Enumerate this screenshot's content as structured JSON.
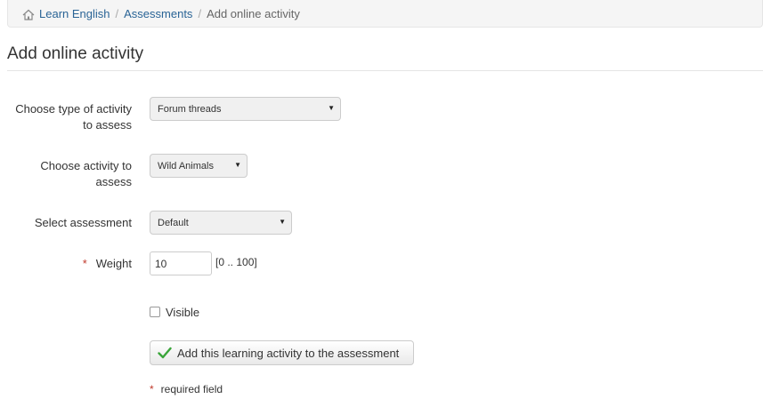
{
  "breadcrumb": {
    "items": [
      "Learn English",
      "Assessments"
    ],
    "separator": "/",
    "current": "Add online activity"
  },
  "page": {
    "title": "Add online activity"
  },
  "form": {
    "activity_type": {
      "label": "Choose type of activity to assess",
      "value": "Forum threads"
    },
    "activity": {
      "label": "Choose activity to assess",
      "value": "Wild Animals"
    },
    "assessment": {
      "label": "Select assessment",
      "value": "Default"
    },
    "weight": {
      "label": "Weight",
      "required_mark": "*",
      "value": "10",
      "range": "[0 .. 100]"
    },
    "visible": {
      "label": "Visible",
      "checked": false
    },
    "submit_label": "Add this learning activity to the assessment"
  },
  "footnote": {
    "star": "*",
    "text": "required field"
  },
  "colors": {
    "link": "#2a6496",
    "required": "#c0392b",
    "check": "#3aa53a"
  }
}
